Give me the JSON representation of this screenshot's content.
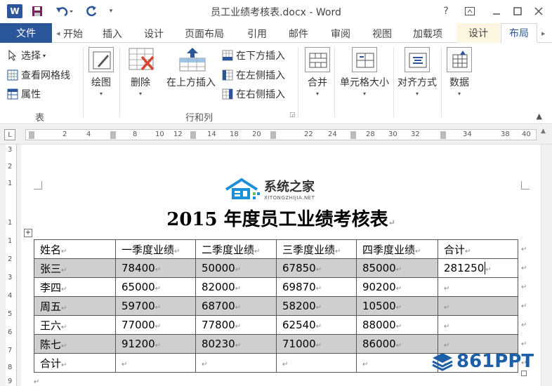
{
  "titlebar": {
    "title": "员工业绩考核表.docx - Word",
    "help": "?",
    "word_logo": "W",
    "qa_more": "▾"
  },
  "tabs": {
    "file": "文件",
    "items": [
      "开始",
      "插入",
      "设计",
      "页面布局",
      "引用",
      "邮件",
      "审阅",
      "视图",
      "加载项"
    ],
    "context": [
      "设计",
      "布局"
    ],
    "active": "布局",
    "first_partial": "Ŧ始"
  },
  "ribbon": {
    "table_group": {
      "select": "选择",
      "gridlines": "查看网格线",
      "properties": "属性",
      "label": "表"
    },
    "draw": "绘图",
    "rows_cols": {
      "delete": "删除",
      "insert_above": "在上方插入",
      "insert_below": "在下方插入",
      "insert_left": "在左侧插入",
      "insert_right": "在右侧插入",
      "label": "行和列"
    },
    "merge": "合并",
    "cell_size": "单元格大小",
    "align": "对齐方式",
    "data": "数据"
  },
  "ruler": {
    "ticks": [
      "2",
      "4",
      "8",
      "10",
      "12",
      "14",
      "18",
      "20",
      "22",
      "24",
      "28",
      "30",
      "32",
      "34",
      "38",
      "40"
    ],
    "vticks": [
      "3",
      "2",
      "1",
      "1",
      "1",
      "2",
      "3",
      "4",
      "5",
      "6",
      "7",
      "8",
      "9"
    ],
    "corner": "L"
  },
  "document": {
    "logo_name": "系统之家",
    "logo_url": "XITONGZHIJIA.NET",
    "title": "2015 年度员工业绩考核表",
    "mark": "↵",
    "header": [
      "姓名",
      "一季度业绩",
      "二季度业绩",
      "三季度业绩",
      "四季度业绩",
      "合计"
    ],
    "rows": [
      [
        "张三",
        "78400",
        "50000",
        "67850",
        "85000",
        "281250"
      ],
      [
        "李四",
        "65000",
        "82000",
        "69870",
        "90200",
        ""
      ],
      [
        "周五",
        "59700",
        "68700",
        "58200",
        "10500",
        ""
      ],
      [
        "王六",
        "77000",
        "77800",
        "62540",
        "88000",
        ""
      ],
      [
        "陈七",
        "91200",
        "80230",
        "71000",
        "86000",
        ""
      ],
      [
        "合计",
        "",
        "",
        "",
        "",
        ""
      ]
    ]
  },
  "watermark": "861PPT",
  "colors": {
    "accent": "#2b579a",
    "shade": "#cfcfcf",
    "watermark": "#1d5fa7"
  }
}
